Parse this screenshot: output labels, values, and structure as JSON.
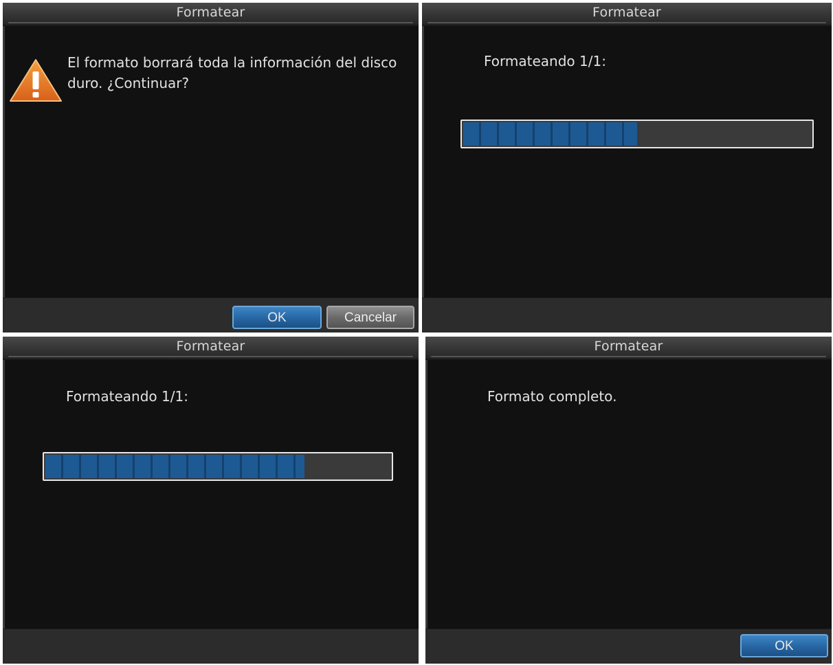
{
  "panels": {
    "confirm": {
      "title": "Formatear",
      "message": "El formato borrará toda la información del disco duro. ¿Continuar?",
      "ok_label": "OK",
      "cancel_label": "Cancelar",
      "icon": "warning-icon"
    },
    "progress_a": {
      "title": "Formatear",
      "message": "Formateando 1/1:",
      "progress_fraction": 0.5
    },
    "progress_b": {
      "title": "Formatear",
      "message": "Formateando 1/1:",
      "progress_fraction": 0.75
    },
    "complete": {
      "title": "Formatear",
      "message": "Formato completo.",
      "ok_label": "OK"
    }
  },
  "colors": {
    "panel_bg": "#111111",
    "accent_blue": "#2768a6",
    "progress_blue": "#1d5a94",
    "warning_orange": "#e8781e"
  }
}
